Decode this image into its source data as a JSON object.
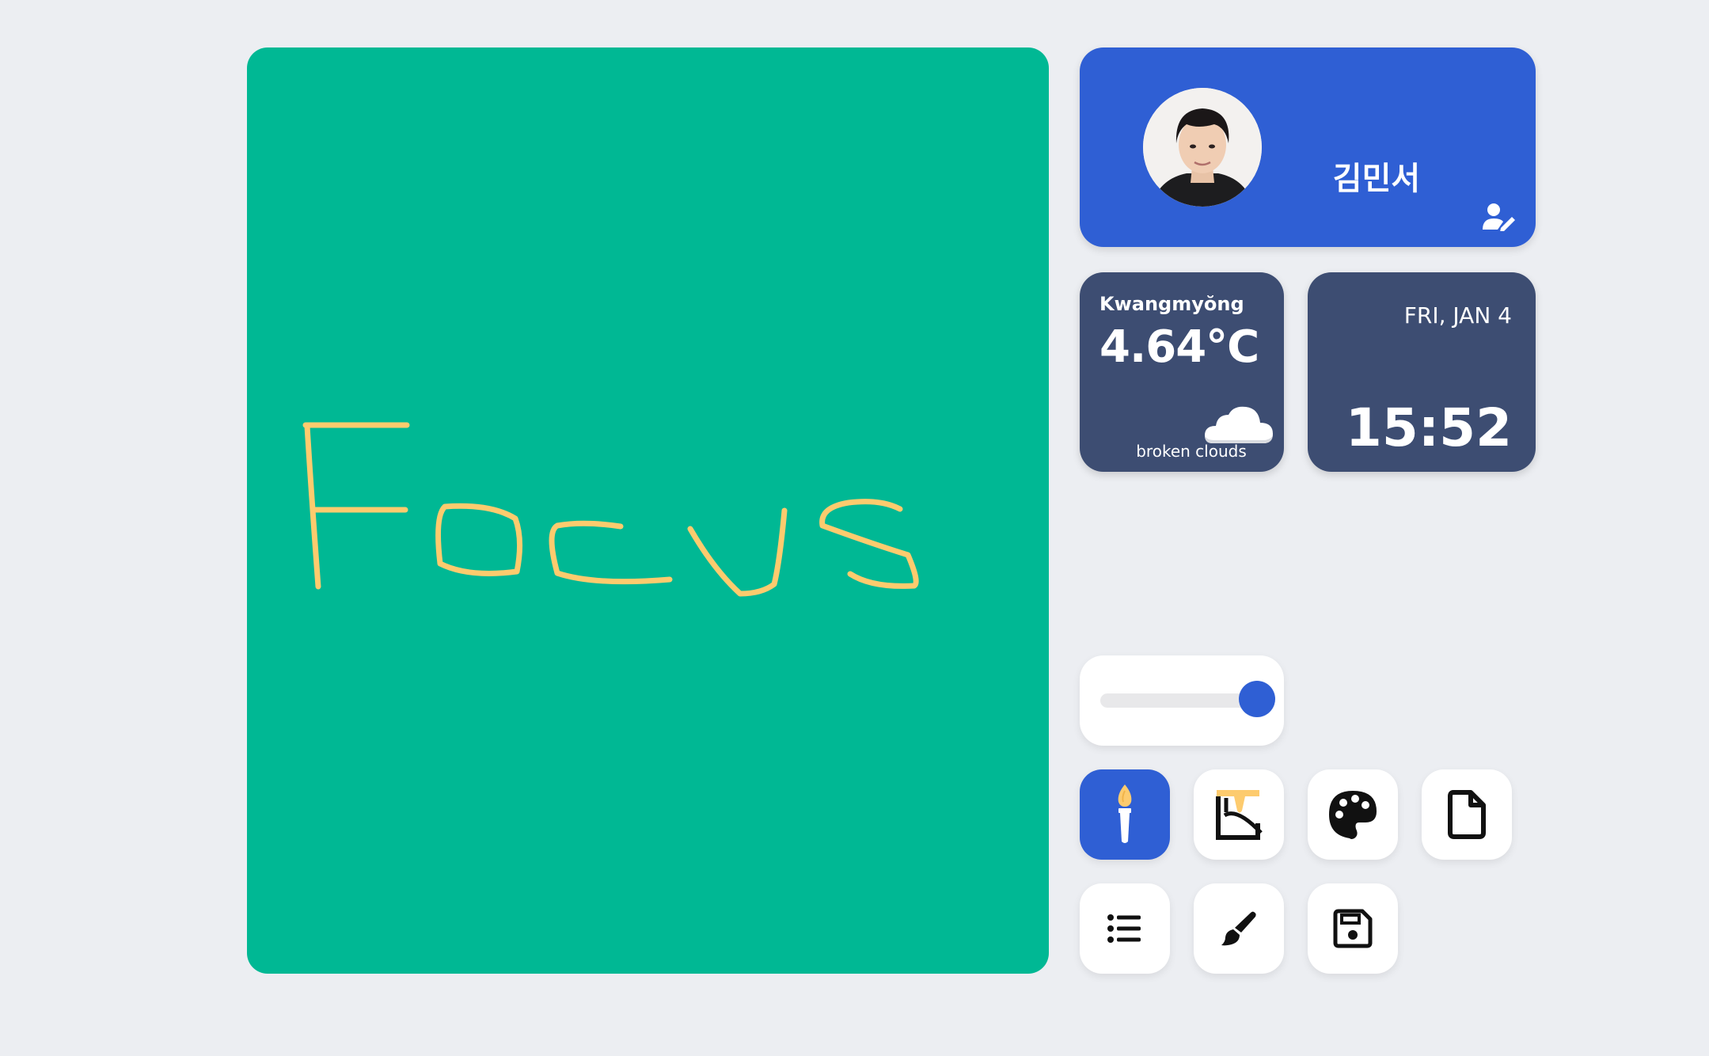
{
  "profile": {
    "name": "김민서"
  },
  "weather": {
    "city": "Kwangmyŏng",
    "temperature": "4.64°C",
    "description": "broken clouds",
    "icon": "cloud-icon"
  },
  "datetime": {
    "date": "FRI, JAN 4",
    "time": "15:52"
  },
  "brush_size": {
    "value_fraction": 1.0
  },
  "tools": [
    {
      "name": "brush-tool",
      "icon": "paintbrush-icon",
      "active": true
    },
    {
      "name": "fill-tool",
      "icon": "paint-bucket-icon",
      "active": false
    },
    {
      "name": "palette-tool",
      "icon": "palette-icon",
      "active": false
    },
    {
      "name": "new-file-tool",
      "icon": "file-icon",
      "active": false
    },
    {
      "name": "list-tool",
      "icon": "list-icon",
      "active": false
    },
    {
      "name": "paint-brush-tool",
      "icon": "brush-icon",
      "active": false
    },
    {
      "name": "save-tool",
      "icon": "save-icon",
      "active": false
    }
  ],
  "colors": {
    "canvas": "#00b894",
    "stroke": "#fdcb6e",
    "accent": "#2f5fd4",
    "tile": "#3d4d72"
  }
}
